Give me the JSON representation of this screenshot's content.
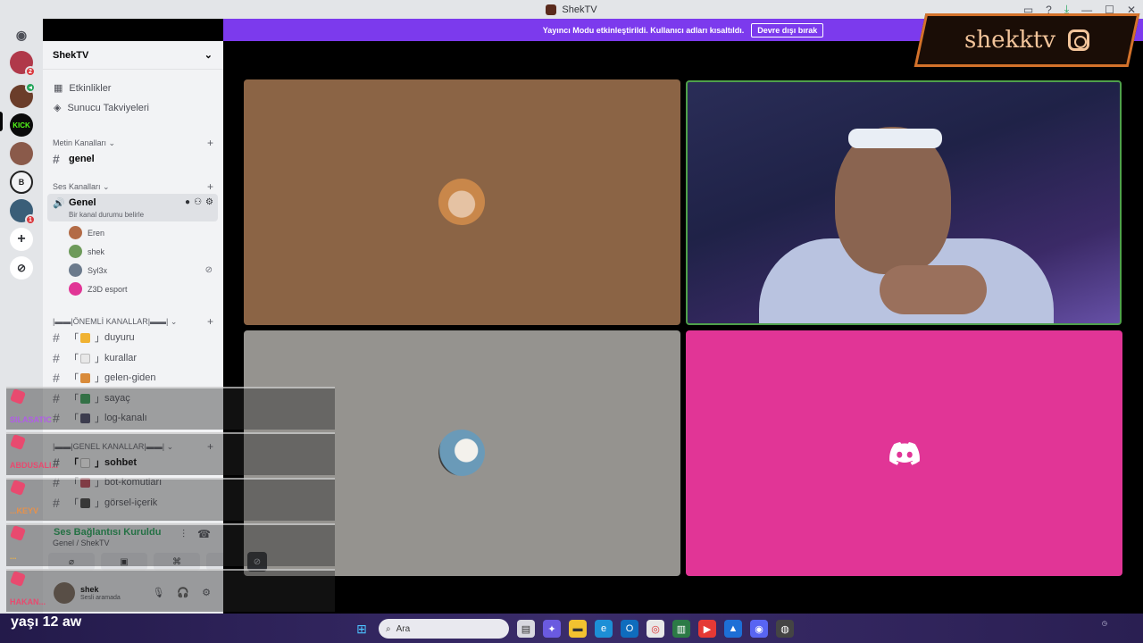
{
  "window": {
    "title": "ShekTV"
  },
  "notice": {
    "text": "Yayıncı Modu etkinleştirildi. Kullanıcı adları kısaltıldı.",
    "button": "Devre dışı bırak"
  },
  "server": {
    "name": "ShekTV"
  },
  "nav": {
    "events": "Etkinlikler",
    "boosts": "Sunucu Takviyeleri"
  },
  "categories": {
    "text": "Metin Kanalları",
    "voice": "Ses Kanalları",
    "important": "|▬▬|ÖNEMLİ KANALLAR|▬▬|",
    "general": "|▬▬|GENEL KANALLAR|▬▬|"
  },
  "text_channels": [
    {
      "name": "genel"
    }
  ],
  "voice_channel": {
    "name": "Genel",
    "status": "Bir kanal durumu belirle"
  },
  "voice_users": [
    {
      "name": "Eren"
    },
    {
      "name": "shek"
    },
    {
      "name": "Syl3x"
    },
    {
      "name": "Z3D esport"
    }
  ],
  "important_channels": [
    {
      "name": "duyuru"
    },
    {
      "name": "kurallar"
    },
    {
      "name": "gelen-giden"
    },
    {
      "name": "sayaç"
    },
    {
      "name": "log-kanalı"
    }
  ],
  "general_channels": [
    {
      "name": "sohbet"
    },
    {
      "name": "bot-komutları"
    },
    {
      "name": "görsel-içerik"
    }
  ],
  "voice_panel": {
    "status": "Ses Bağlantısı Kuruldu",
    "location": "Genel / ShekTV"
  },
  "user_panel": {
    "name": "shek",
    "status": "Sesli aramada"
  },
  "overlay": {
    "logo_text": "shekktv",
    "chat_names": [
      "SILASATIC",
      "ABDUSALI...",
      "...KEYV",
      "...",
      "HAKAN..."
    ],
    "stream_text": "yaşı 12 aw"
  },
  "taskbar": {
    "search_placeholder": "Ara"
  },
  "colors": {
    "accent": "#7c3aed",
    "online": "#23a55a",
    "speaking_border": "#4fa14b",
    "discord_tile": "#e13596",
    "logo_border": "#d3722b"
  }
}
